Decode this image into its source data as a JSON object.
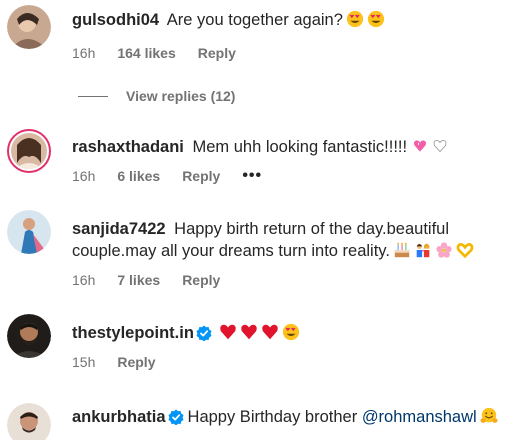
{
  "comments": [
    {
      "username": "gulsodhi04",
      "text": "Are you together again?",
      "emojis": [
        "heart-eyes",
        "heart-eyes"
      ],
      "time": "16h",
      "likes": "164 likes",
      "reply": "Reply",
      "verified": false
    },
    {
      "username": "rashaxthadani",
      "text": "Mem uhh looking fantastic!!!!!",
      "emojis": [
        "sparkling-heart",
        "white-heart"
      ],
      "time": "16h",
      "likes": "6 likes",
      "reply": "Reply",
      "more": "•••",
      "verified": false
    },
    {
      "username": "sanjida7422",
      "text": "Happy birth return of the day.beautiful couple.may all your dreams turn into reality.",
      "emojis": [
        "birthday-cake",
        "couple",
        "flower",
        "heart-hands"
      ],
      "time": "16h",
      "likes": "7 likes",
      "reply": "Reply",
      "verified": false
    },
    {
      "username": "thestylepoint.in",
      "text": "",
      "emojis": [
        "red-heart",
        "red-heart",
        "red-heart",
        "heart-eyes"
      ],
      "time": "15h",
      "likes": "",
      "reply": "Reply",
      "verified": true
    },
    {
      "username": "ankurbhatia",
      "text": "Happy Birthday brother",
      "mention": "@rohmanshawl",
      "emojis": [
        "hugging-face"
      ],
      "verified": true
    }
  ],
  "view_replies": "View replies (12)",
  "colors": {
    "text": "#262626",
    "muted": "#737373",
    "mention": "#00376b",
    "verified": "#0095f6",
    "story_ring": "#e1306c"
  }
}
